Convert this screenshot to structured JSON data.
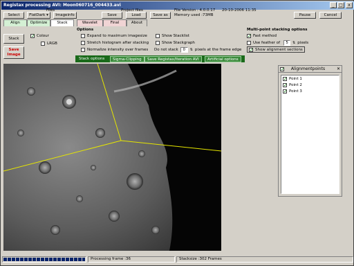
{
  "window": {
    "title": "Registax processing AVI: Moon060716_004433.avi",
    "minimize": "_",
    "maximize": "□",
    "close": "x"
  },
  "toolbar": {
    "files_label": "Files",
    "select_label": "Select",
    "flatdark_label": "FlatDark",
    "imageinfo_label": "Imageinfo",
    "project_files_label": "Project files",
    "save_label": "Save",
    "load_label": "Load",
    "saveas_label": "Save as",
    "file_version": "File Version : 4.0.0.17",
    "date": "20-10-2006 11:35",
    "memory": "Memory used :73MB",
    "pause_label": "Pause",
    "cancel_label": "Cancel"
  },
  "tabs": [
    {
      "label": "Align",
      "color": "#d4f0d4"
    },
    {
      "label": "Optimize",
      "color": "#d4f0d4"
    },
    {
      "label": "Stack",
      "color": "#ffffff"
    },
    {
      "label": "Wavelet",
      "color": "#f0d4d4"
    },
    {
      "label": "Final",
      "color": "#f0d4d4"
    },
    {
      "label": "About",
      "color": "#d4d0c8"
    }
  ],
  "left": {
    "stack_label": "Stack",
    "save_image_line1": "Save",
    "save_image_line2": "Image",
    "colour_label": "Colour",
    "lrgb_label": "LRGB"
  },
  "options": {
    "title": "Options",
    "expand": "Expand to maximum imagesize",
    "stretch": "Stretch histogram after stacking",
    "normalize": "Normalize intensity over frames",
    "show_stacklist": "Show Stacklist",
    "show_stackgraph": "Show Stackgraph",
    "do_not_stack": "Do not stack",
    "pixels_value": "0",
    "pixels_edge": "pixels at the frame edge"
  },
  "multipoint": {
    "title": "Multi-point stacking options",
    "fast_method": "Fast method",
    "feather_label": "Use feather of",
    "feather_value": "5",
    "feather_unit": "pixels",
    "show_alignment": "Show alignment sections"
  },
  "subtabs": [
    "Stack options",
    "Sigma-Clipping",
    "Save Registax/Iteration AVI",
    "Artificial options"
  ],
  "alignpoints": {
    "title": "Alignmentpoints",
    "points": [
      "Point 1",
      "Point 2",
      "Point 3"
    ]
  },
  "status": {
    "progress_fraction": 1.0,
    "processing": "Processing frame :36",
    "stacksize": "Stacksize :302 Frames"
  },
  "colors": {
    "title_bar": "#0a246a",
    "progress": "#0a246a",
    "save_image_text": "#cc0000",
    "stack_tab_strip": "#1a6a1a"
  }
}
